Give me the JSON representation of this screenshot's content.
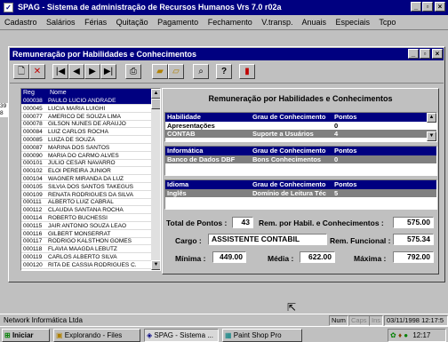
{
  "main_window": {
    "title": "SPAG - Sistema de administração de Recursos Humanos Vrs 7.0 r02a"
  },
  "menu": [
    "Cadastro",
    "Salários",
    "Férias",
    "Quitação",
    "Pagamento",
    "Fechamento",
    "V.transp.",
    "Anuais",
    "Especiais",
    "Tcpo"
  ],
  "left_fragments": [
    "39",
    "8"
  ],
  "dialog": {
    "title": "Remuneração por Habilidades e Conhecimentos",
    "panel_title": "Remuneração por Habilidades e Conhecimentos"
  },
  "list": {
    "headers": {
      "reg": "Reg",
      "name": "Nome"
    },
    "rows": [
      [
        "000038",
        "PAULO LUCIO ANDRADE"
      ],
      [
        "000045",
        "LUCIA MARIA LUIGHI"
      ],
      [
        "000077",
        "AMERICO DE SOUZA LIMA"
      ],
      [
        "000078",
        "GILSON NUNES DE ARAUJO"
      ],
      [
        "000084",
        "LUIZ CARLOS ROCHA"
      ],
      [
        "000085",
        "LUIZA DE SOUZA"
      ],
      [
        "000087",
        "MARINA DOS SANTOS"
      ],
      [
        "000090",
        "MARIA DO CARMO ALVES"
      ],
      [
        "000101",
        "JULIO CESAR NAVARRO"
      ],
      [
        "000102",
        "ELOI PEREIRA JUNIOR"
      ],
      [
        "000104",
        "WAGNER MIRANDA DA LUZ"
      ],
      [
        "000105",
        "SILVIA DOS SANTOS TAKEGUS"
      ],
      [
        "000109",
        "RENATA RODRIGUES DA SILVA"
      ],
      [
        "000111",
        "ALBERTO LUIZ CABRAL"
      ],
      [
        "000112",
        "CLAUDIA SANTANA ROCHA"
      ],
      [
        "000114",
        "ROBERTO BUCHESSI"
      ],
      [
        "000115",
        "JAIR ANTONIO SOUZA LEAO"
      ],
      [
        "000116",
        "GILBERT MONSERRAT"
      ],
      [
        "000117",
        "RODRIGO KALSTHON GOMES"
      ],
      [
        "000118",
        "FLAVIA MAAGDA LEBUTZ"
      ],
      [
        "000119",
        "CARLOS ALBERTO SILVA"
      ],
      [
        "000120",
        "RITA DE CASSIA RODRIGUES C."
      ]
    ]
  },
  "habilidade_grid": {
    "headers": [
      "Habilidade",
      "Grau de Conhecimento",
      "Pontos"
    ],
    "rows": [
      [
        "Apresentações",
        "",
        "0"
      ],
      [
        "CONTAB",
        "Suporte a Usuários",
        "4"
      ]
    ]
  },
  "informatica_grid": {
    "headers": [
      "Informática",
      "Grau de Conhecimento",
      "Pontos"
    ],
    "rows": [
      [
        "Banco de Dados DBF",
        "Bons Conhecimentos",
        "0"
      ]
    ]
  },
  "idioma_grid": {
    "headers": [
      "Idioma",
      "Grau de Conhecimento",
      "Pontos"
    ],
    "rows": [
      [
        "Inglês",
        "Domínio de Leitura Téc",
        "5"
      ]
    ]
  },
  "summary": {
    "total_pontos_label": "Total de Pontos :",
    "total_pontos": "43",
    "rem_hab_label": "Rem. por Habil. e Conhecimentos :",
    "rem_hab": "575.00",
    "cargo_label": "Cargo :",
    "cargo": "ASSISTENTE CONTABIL",
    "rem_func_label": "Rem. Funcional :",
    "rem_func": "575.34",
    "minima_label": "Mínima :",
    "minima": "449.00",
    "media_label": "Média :",
    "media": "622.00",
    "maxima_label": "Máxima :",
    "maxima": "792.00"
  },
  "statusbar": {
    "company": "Network Informática Ltda",
    "num": "Num",
    "caps": "Caps",
    "ins": "Ins",
    "datetime": "03/11/1998 12:17:5"
  },
  "taskbar": {
    "start": "Iniciar",
    "tasks": [
      "Explorando - Files",
      "SPAG - Sistema ...",
      "Paint Shop Pro"
    ],
    "clock": "12:17"
  },
  "colors": {
    "title_blue": "#000080",
    "face": "#c0c0c0",
    "teal_bg": "#008080"
  }
}
